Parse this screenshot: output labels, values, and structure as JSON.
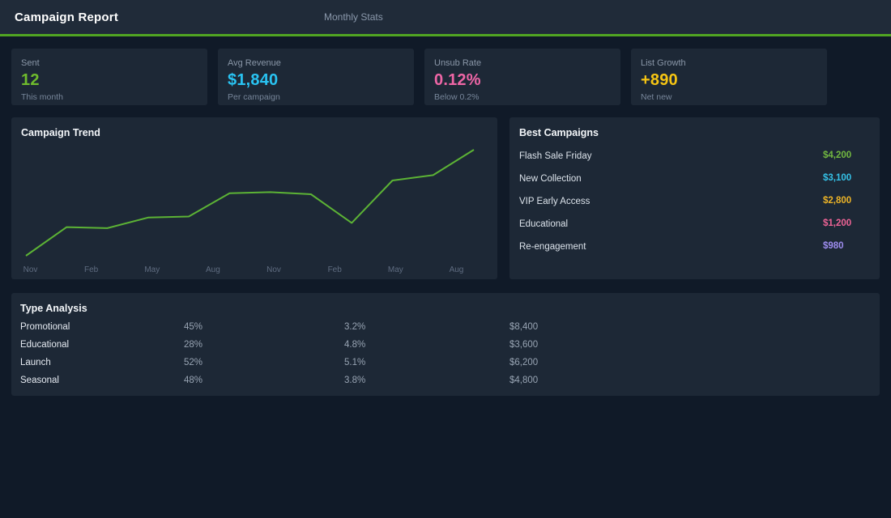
{
  "header": {
    "title": "Campaign Report",
    "nav": "Monthly Stats"
  },
  "colors": {
    "accent_green": "#50a522",
    "page_bg": "#101a28",
    "panel_bg": "#1d2836"
  },
  "stats": [
    {
      "label": "Sent",
      "value": "12",
      "sub": "This month",
      "color": "#6fbb2d"
    },
    {
      "label": "Avg Revenue",
      "value": "$1,840",
      "sub": "Per campaign",
      "color": "#29c3f2"
    },
    {
      "label": "Unsub Rate",
      "value": "0.12%",
      "sub": "Below 0.2%",
      "color": "#ee66a6"
    },
    {
      "label": "List Growth",
      "value": "+890",
      "sub": "Net new",
      "color": "#f6c513"
    }
  ],
  "chart_data": {
    "type": "line",
    "title": "Campaign Trend",
    "x_tick_labels": [
      "Nov",
      "Feb",
      "May",
      "Aug",
      "Nov",
      "Feb",
      "May",
      "Aug"
    ],
    "values": [
      0,
      27,
      26,
      36,
      37,
      59,
      60,
      58,
      31,
      71,
      76,
      100
    ],
    "ylim": [
      0,
      100
    ],
    "y_axis_visible": false,
    "grid": false,
    "legend": "none",
    "line_color": "#5cb335",
    "note_units": "relative scale estimated from pixel heights; no y-axis shown"
  },
  "best_campaigns": {
    "title": "Best Campaigns",
    "rows": [
      {
        "name": "Flash Sale Friday",
        "value": "$4,200",
        "color": "#72b840"
      },
      {
        "name": "New Collection",
        "value": "$3,100",
        "color": "#35c2e8"
      },
      {
        "name": "VIP Early Access",
        "value": "$2,800",
        "color": "#edb427"
      },
      {
        "name": "Educational",
        "value": "$1,200",
        "color": "#ed6395"
      },
      {
        "name": "Re-engagement",
        "value": "$980",
        "color": "#9e8df0"
      }
    ]
  },
  "type_analysis": {
    "title": "Type Analysis",
    "rows": [
      {
        "type": "Promotional",
        "pct1": "45%",
        "pct2": "3.2%",
        "revenue": "$8,400"
      },
      {
        "type": "Educational",
        "pct1": "28%",
        "pct2": "4.8%",
        "revenue": "$3,600"
      },
      {
        "type": "Launch",
        "pct1": "52%",
        "pct2": "5.1%",
        "revenue": "$6,200"
      },
      {
        "type": "Seasonal",
        "pct1": "48%",
        "pct2": "3.8%",
        "revenue": "$4,800"
      }
    ]
  }
}
